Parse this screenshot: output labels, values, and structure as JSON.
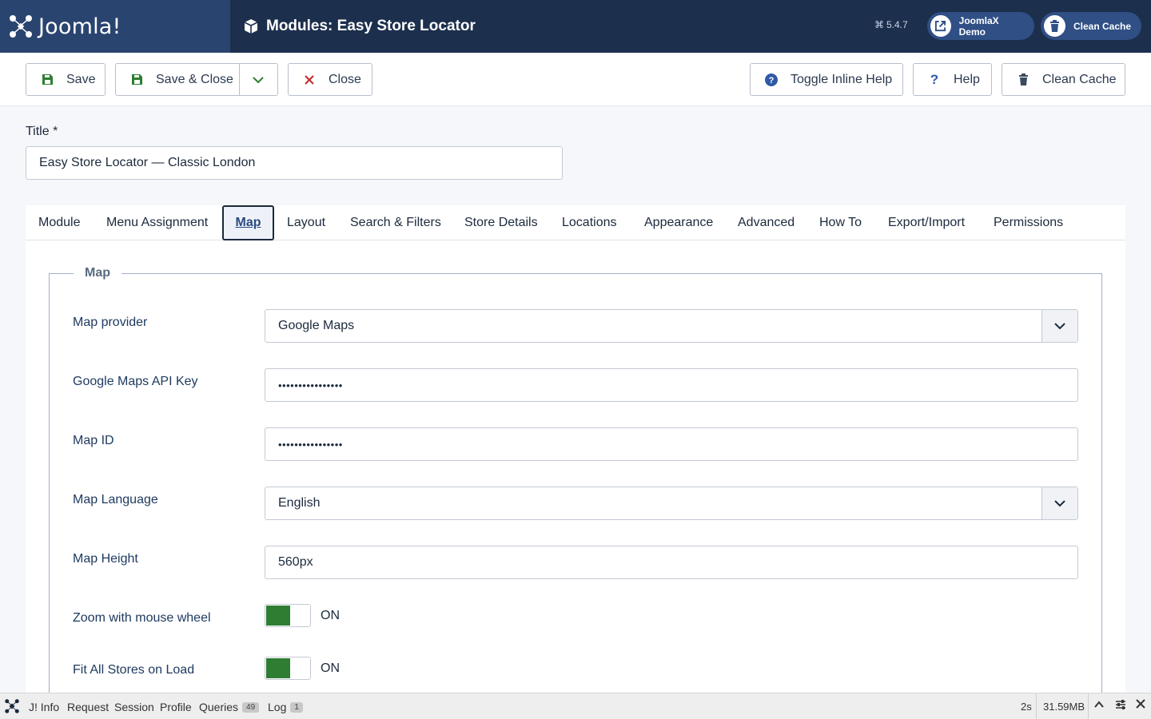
{
  "header": {
    "brand_text": "Joomla!",
    "page_title": "Modules: Easy Store Locator",
    "version": "5.4.7",
    "demo_label": "JoomlaX Demo",
    "clean_cache_label": "Clean Cache"
  },
  "toolbar": {
    "save": "Save",
    "save_close": "Save & Close",
    "close": "Close",
    "toggle_help": "Toggle Inline Help",
    "help": "Help",
    "clean_cache": "Clean Cache"
  },
  "form": {
    "title_label": "Title *",
    "title_value": "Easy Store Locator — Classic London"
  },
  "tabs": [
    "Module",
    "Menu Assignment",
    "Map",
    "Layout",
    "Search & Filters",
    "Store Details",
    "Locations",
    "Appearance",
    "Advanced",
    "How To",
    "Export/Import",
    "Permissions"
  ],
  "active_tab": "Map",
  "map": {
    "legend": "Map",
    "provider_label": "Map provider",
    "provider_value": "Google Maps",
    "api_key_label": "Google Maps API Key",
    "api_key_value": "••••••••••••••••",
    "map_id_label": "Map ID",
    "map_id_value": "••••••••••••••••",
    "language_label": "Map Language",
    "language_value": "English",
    "height_label": "Map Height",
    "height_value": "560px",
    "zoom_label": "Zoom with mouse wheel",
    "zoom_state": "ON",
    "fit_label": "Fit All Stores on Load",
    "fit_state": "ON"
  },
  "debug": {
    "info": "J! Info",
    "request": "Request",
    "session": "Session",
    "profile": "Profile",
    "queries": "Queries",
    "queries_count": "49",
    "log": "Log",
    "log_count": "1",
    "time": "2s",
    "memory": "31.59MB"
  },
  "colors": {
    "header_bg": "#1c2f4d",
    "brand_bg": "#2a4470",
    "toggle_on": "#2e7d32",
    "close_icon": "#c62828",
    "save_icon": "#2e7d32",
    "help_icon": "#3059a8"
  }
}
